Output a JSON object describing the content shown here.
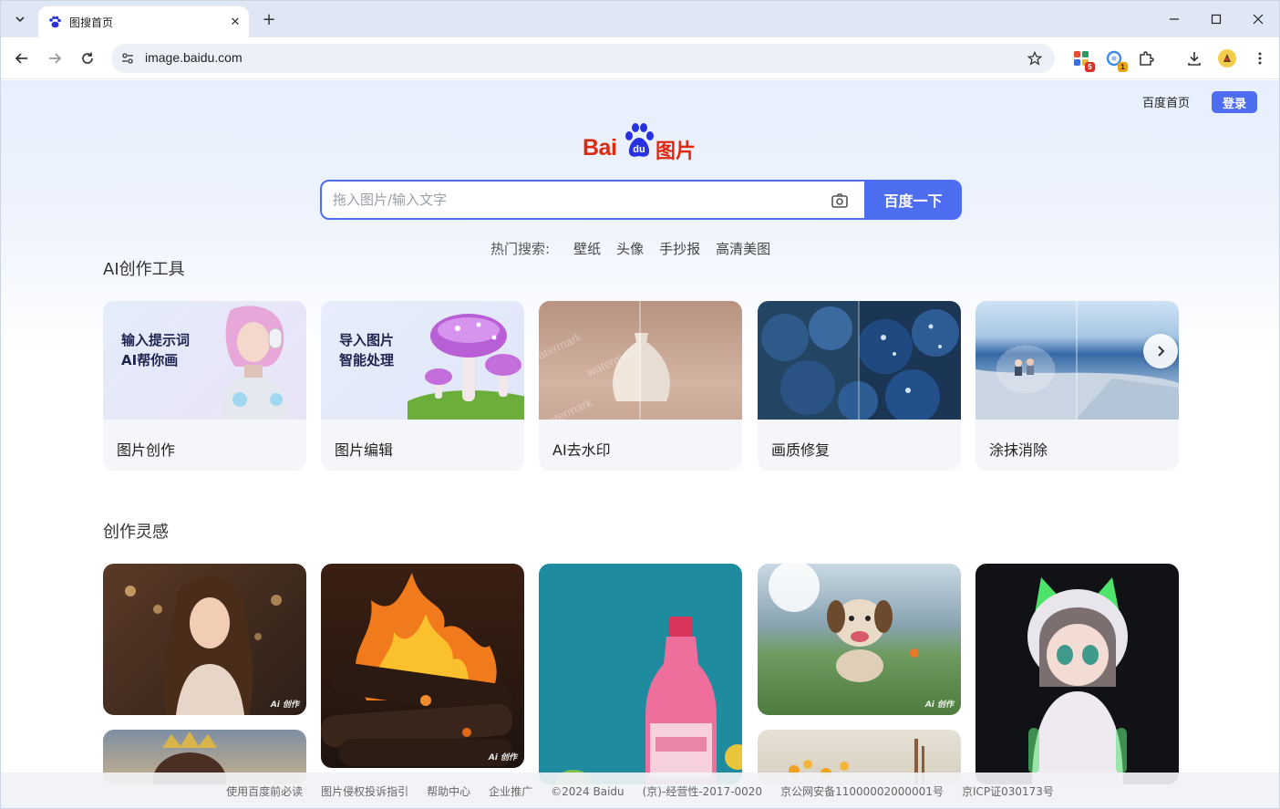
{
  "browser": {
    "tab_title": "图搜首页",
    "url": "image.baidu.com",
    "extensions": [
      {
        "name": "apps-extension",
        "badge": "5",
        "badge_color": "#d93025"
      },
      {
        "name": "sync-extension",
        "badge": "1",
        "badge_color": "#e8a317"
      }
    ]
  },
  "header": {
    "home_link": "百度首页",
    "login_label": "登录"
  },
  "logo": {
    "brand": "Bai",
    "paw_text": "du",
    "product": "图片"
  },
  "search": {
    "placeholder": "拖入图片/输入文字",
    "button_label": "百度一下"
  },
  "hot_search": {
    "label": "热门搜索:",
    "keywords": [
      "壁纸",
      "头像",
      "手抄报",
      "高清美图"
    ]
  },
  "ai_tools": {
    "title": "AI创作工具",
    "items": [
      {
        "label": "图片创作",
        "thumb_text": [
          "输入提示词",
          "AI帮你画"
        ]
      },
      {
        "label": "图片编辑",
        "thumb_text": [
          "导入图片",
          "智能处理"
        ]
      },
      {
        "label": "AI去水印",
        "thumb_text": [
          "watermark"
        ]
      },
      {
        "label": "画质修复"
      },
      {
        "label": "涂抹消除"
      }
    ]
  },
  "inspiration": {
    "title": "创作灵感",
    "ai_tag": "Ai 创作"
  },
  "footer": {
    "links": [
      "使用百度前必读",
      "图片侵权投诉指引",
      "帮助中心",
      "企业推广",
      "©2024 Baidu",
      "(京)-经营性-2017-0020",
      "京公网安备11000002000001号",
      "京ICP证030173号"
    ]
  },
  "colors": {
    "accent": "#4e6ef2",
    "brand_red": "#de2910",
    "brand_blue": "#2932e1"
  }
}
